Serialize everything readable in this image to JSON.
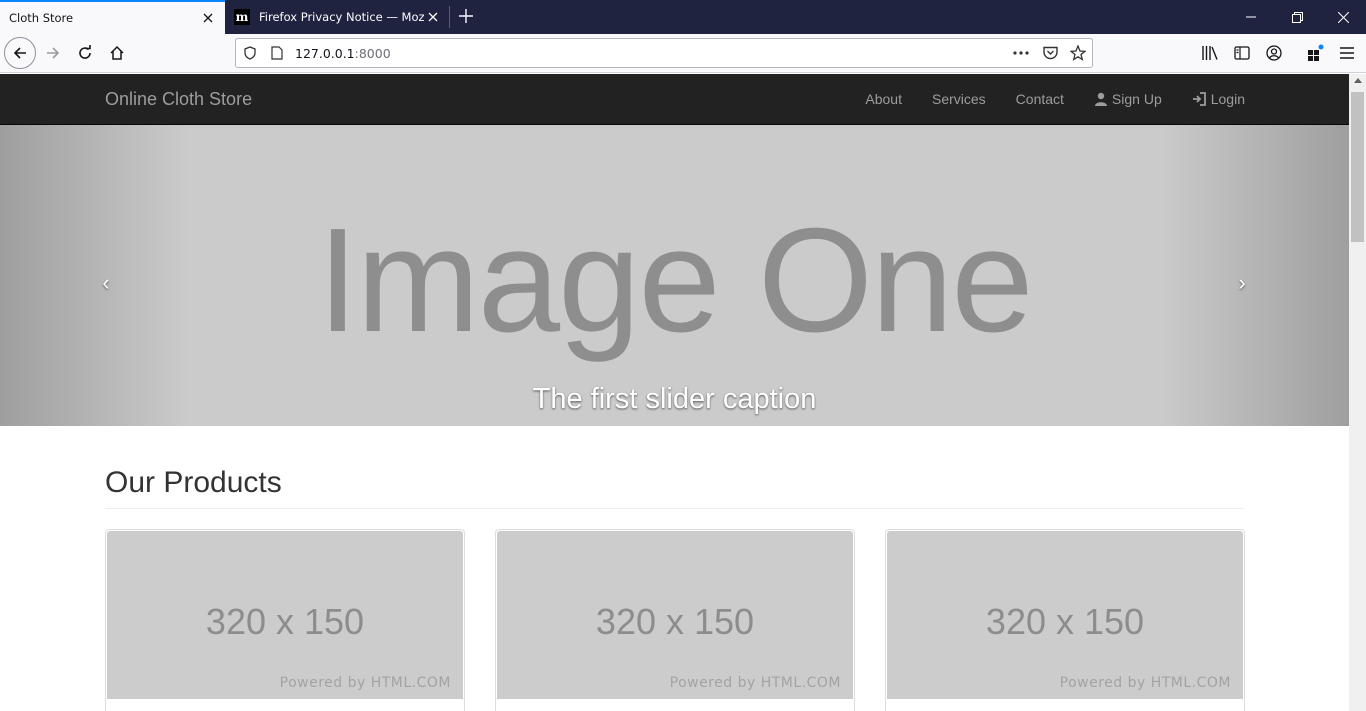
{
  "browser": {
    "tabs": [
      {
        "title": "Cloth Store",
        "active": true
      },
      {
        "title": "Firefox Privacy Notice — Mozill",
        "active": false,
        "favicon": "m"
      }
    ],
    "url": {
      "host": "127.0.0.1",
      "port": ":8000"
    }
  },
  "site": {
    "brand": "Online Cloth Store",
    "nav": {
      "about": "About",
      "services": "Services",
      "contact": "Contact",
      "signup": "Sign Up",
      "login": "Login"
    },
    "carousel": {
      "image_text": "Image One",
      "caption": "The first slider caption",
      "prev": "‹",
      "next": "›",
      "slides": 3,
      "active_index": 0
    },
    "products": {
      "title": "Our Products",
      "cards": [
        {
          "image_text": "320 x 150",
          "powered": "Powered by HTML.COM"
        },
        {
          "image_text": "320 x 150",
          "powered": "Powered by HTML.COM"
        },
        {
          "image_text": "320 x 150",
          "powered": "Powered by HTML.COM"
        }
      ]
    }
  },
  "colors": {
    "tabbar_bg": "#202340",
    "accent": "#0a84ff",
    "site_navbar": "#222222",
    "carousel_bg": "#cbcbcb"
  }
}
